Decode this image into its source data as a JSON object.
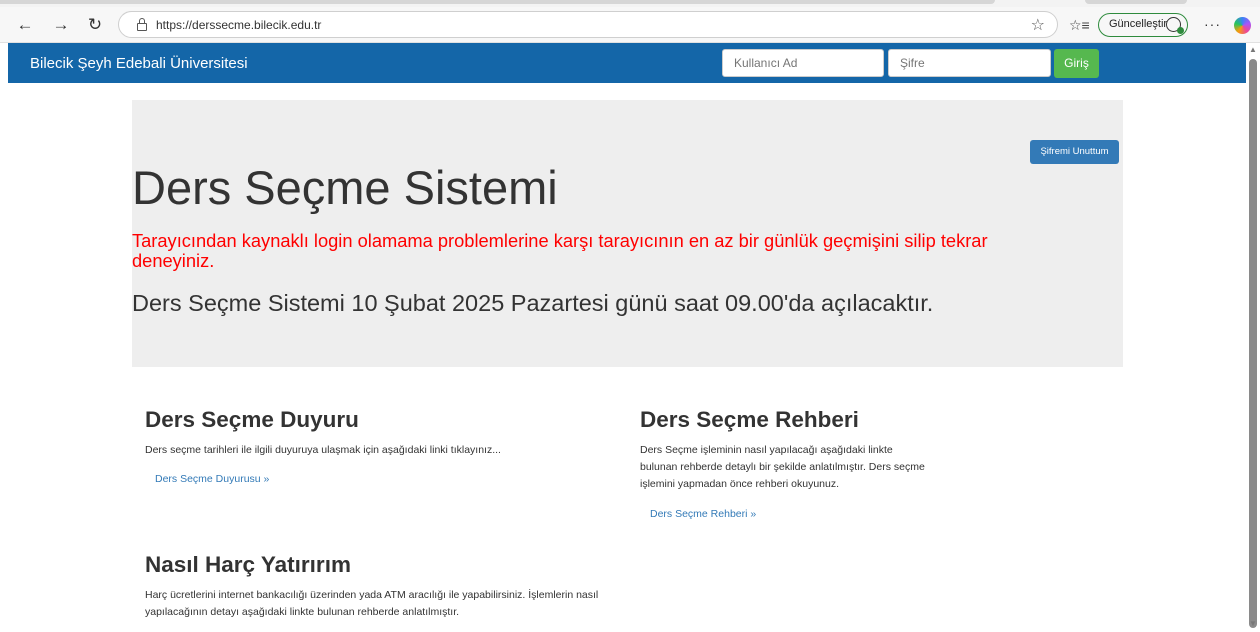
{
  "browser": {
    "url": "https://derssecme.bilecik.edu.tr",
    "update_label": "Güncelleştir",
    "more_label": "···"
  },
  "nav": {
    "brand": "Bilecik Şeyh Edebali Üniversitesi",
    "username_placeholder": "Kullanıcı Ad",
    "password_placeholder": "Şifre",
    "login_label": "Giriş"
  },
  "jumbotron": {
    "forgot_label": "Şifremi Unuttum",
    "title": "Ders Seçme Sistemi",
    "warning": "Tarayıcından kaynaklı login olamama problemlerine karşı tarayıcının en az bir günlük geçmişini silip tekrar deneyiniz.",
    "announcement": "Ders Seçme Sistemi 10 Şubat 2025 Pazartesi günü saat 09.00'da açılacaktır."
  },
  "sections": {
    "duyuru": {
      "title": "Ders Seçme Duyuru",
      "text": "Ders seçme tarihleri ile ilgili duyuruya ulaşmak için aşağıdaki linki tıklayınız...",
      "link": "Ders Seçme Duyurusu »"
    },
    "rehber": {
      "title": "Ders Seçme Rehberi",
      "text": "Ders Seçme işleminin nasıl yapılacağı aşağıdaki linkte bulunan rehberde detaylı bir şekilde anlatılmıştır. Ders seçme işlemini yapmadan önce rehberi okuyunuz.",
      "link": "Ders Seçme Rehberi »"
    },
    "harc": {
      "title": "Nasıl Harç Yatırırım",
      "text": "Harç ücretlerini internet bankacılığı üzerinden yada ATM aracılığı ile yapabilirsiniz. İşlemlerin nasıl yapılacağının detayı aşağıdaki linkte bulunan rehberde anlatılmıştır."
    }
  },
  "colors": {
    "navbar": "#1466a8",
    "login_button": "#56b84f",
    "primary_button": "#337ab7",
    "warning_text": "#ff0000",
    "jumbotron_bg": "#eeeeee"
  }
}
